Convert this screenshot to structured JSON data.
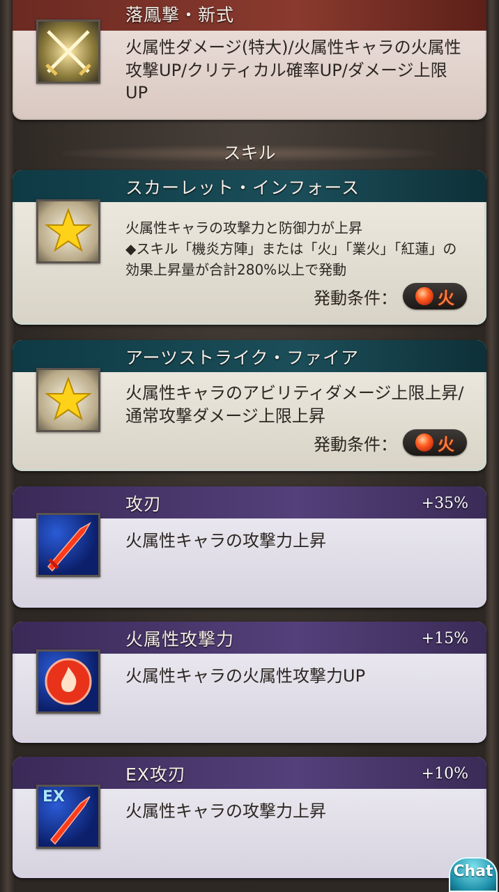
{
  "ougi": {
    "title": "落鳳撃・新式",
    "description": "火属性ダメージ(特大)/火属性キャラの火属性攻撃UP/クリティカル確率UP/ダメージ上限UP",
    "icon": "crossed-swords-icon"
  },
  "section": {
    "skills_label": "スキル"
  },
  "skills": [
    {
      "title": "スカーレット・インフォース",
      "description": "火属性キャラの攻撃力と防御力が上昇\n◆スキル「機炎方陣」または「火」「業火」「紅蓮」の効果上昇量が合計280%以上で発動",
      "condition_label": "発動条件：",
      "condition_element": "火",
      "icon": "star-icon"
    },
    {
      "title": "アーツストライク・ファイア",
      "description": "火属性キャラのアビリティダメージ上限上昇/通常攻撃ダメージ上限上昇",
      "condition_label": "発動条件：",
      "condition_element": "火",
      "icon": "star-icon"
    }
  ],
  "auras": [
    {
      "title": "攻刃",
      "bonus": "+35%",
      "description": "火属性キャラの攻撃力上昇",
      "icon": "red-sword-icon"
    },
    {
      "title": "火属性攻撃力",
      "bonus": "+15%",
      "description": "火属性キャラの火属性攻撃力UP",
      "icon": "fire-emblem-icon"
    },
    {
      "title": "EX攻刃",
      "bonus": "+10%",
      "description": "火属性キャラの攻撃力上昇",
      "icon": "ex-sword-icon",
      "icon_text": "EX"
    }
  ],
  "chat": {
    "label": "Chat"
  },
  "colors": {
    "ougi_header": "#7a3127",
    "skill_header": "#164651",
    "aura_header": "#4a3870",
    "fire": "#ff5b1f"
  }
}
